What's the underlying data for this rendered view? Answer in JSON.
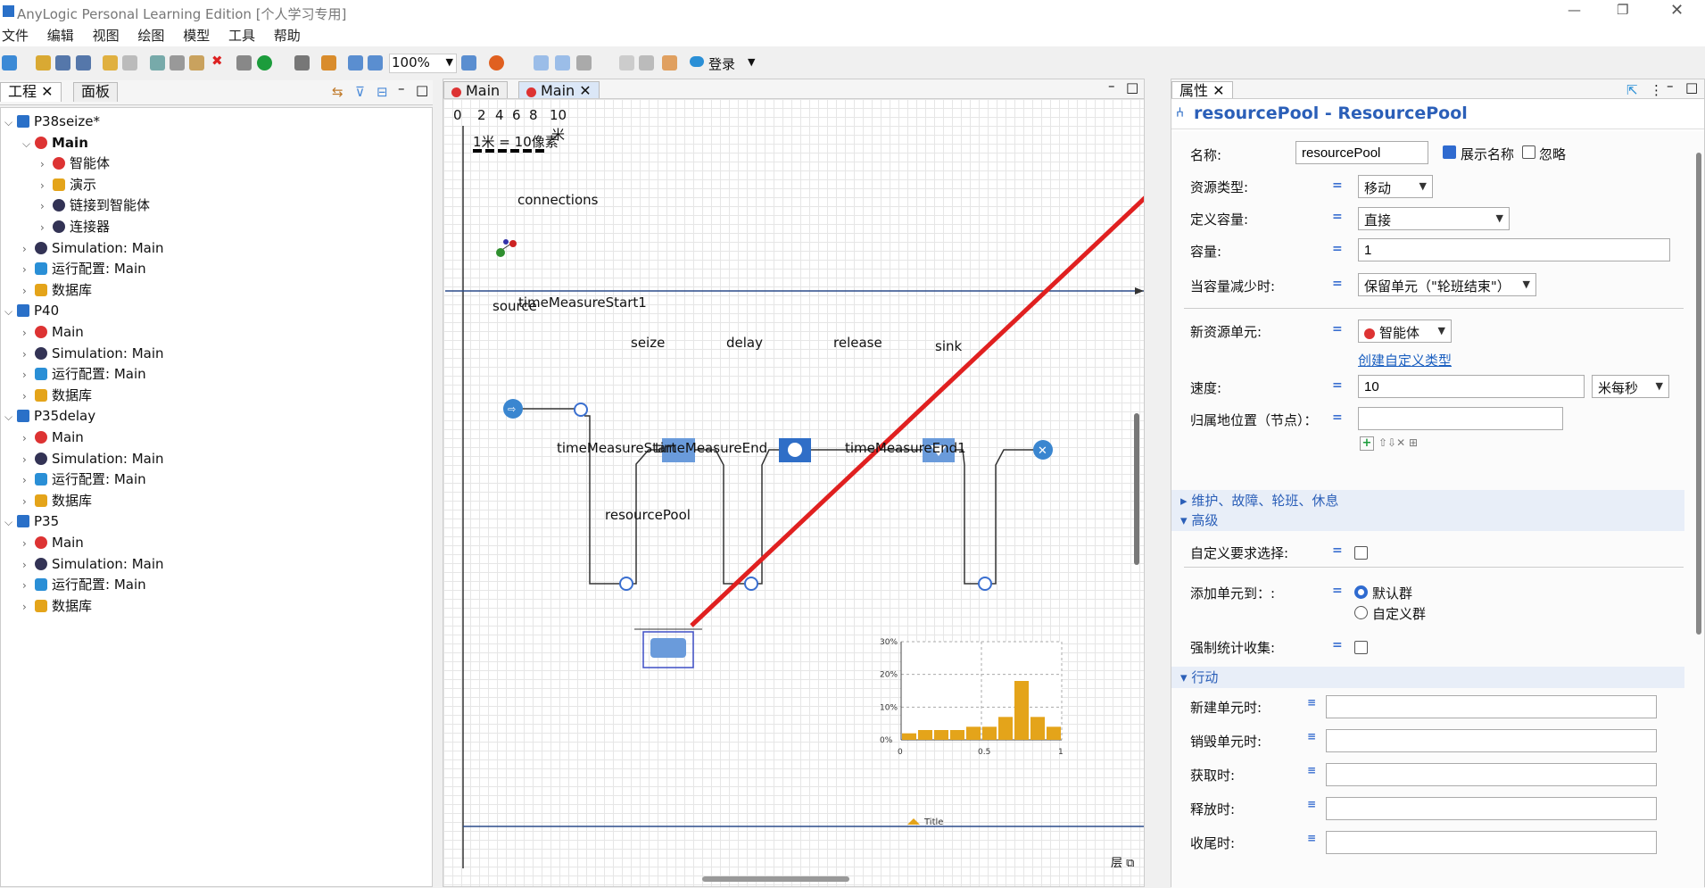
{
  "window": {
    "title": "AnyLogic Personal Learning Edition [个人学习专用]"
  },
  "menu": [
    "文件",
    "编辑",
    "视图",
    "绘图",
    "模型",
    "工具",
    "帮助"
  ],
  "toolbar": {
    "zoom": "100%",
    "login": "登录"
  },
  "left": {
    "tabs": [
      "工程",
      "面板"
    ],
    "tree": [
      {
        "label": "P38seize*",
        "level": 0,
        "icon": "project-icon",
        "expanded": true
      },
      {
        "label": "Main",
        "level": 1,
        "icon": "agent-main-icon",
        "bold": true,
        "expanded": true
      },
      {
        "label": "智能体",
        "level": 2,
        "icon": "agents-icon"
      },
      {
        "label": "演示",
        "level": 2,
        "icon": "presentation-icon"
      },
      {
        "label": "链接到智能体",
        "level": 2,
        "icon": "link-icon"
      },
      {
        "label": "连接器",
        "level": 2,
        "icon": "connector-icon"
      },
      {
        "label": "Simulation: Main",
        "level": 1,
        "icon": "simulation-icon"
      },
      {
        "label": "运行配置: Main",
        "level": 1,
        "icon": "run-config-icon"
      },
      {
        "label": "数据库",
        "level": 1,
        "icon": "database-icon"
      },
      {
        "label": "P40",
        "level": 0,
        "icon": "project-icon",
        "expanded": true
      },
      {
        "label": "Main",
        "level": 1,
        "icon": "agent-main-icon"
      },
      {
        "label": "Simulation: Main",
        "level": 1,
        "icon": "simulation-icon"
      },
      {
        "label": "运行配置: Main",
        "level": 1,
        "icon": "run-config-icon"
      },
      {
        "label": "数据库",
        "level": 1,
        "icon": "database-icon"
      },
      {
        "label": "P35delay",
        "level": 0,
        "icon": "project-icon",
        "expanded": true
      },
      {
        "label": "Main",
        "level": 1,
        "icon": "agent-main-icon"
      },
      {
        "label": "Simulation: Main",
        "level": 1,
        "icon": "simulation-icon"
      },
      {
        "label": "运行配置: Main",
        "level": 1,
        "icon": "run-config-icon"
      },
      {
        "label": "数据库",
        "level": 1,
        "icon": "database-icon"
      },
      {
        "label": "P35",
        "level": 0,
        "icon": "project-icon",
        "expanded": true
      },
      {
        "label": "Main",
        "level": 1,
        "icon": "agent-main-icon"
      },
      {
        "label": "Simulation: Main",
        "level": 1,
        "icon": "simulation-icon"
      },
      {
        "label": "运行配置: Main",
        "level": 1,
        "icon": "run-config-icon"
      },
      {
        "label": "数据库",
        "level": 1,
        "icon": "database-icon"
      }
    ]
  },
  "editor": {
    "tabs": [
      "Main",
      "Main"
    ],
    "scale": {
      "ticks": [
        "0",
        "2",
        "4",
        "6",
        "8",
        "10"
      ],
      "unit": "米",
      "note": "1米 = 10像素"
    },
    "connections": "connections",
    "blocks": {
      "source": "source",
      "tms1": "timeMeasureStart1",
      "seize": "seize",
      "delay": "delay",
      "release": "release",
      "sink": "sink",
      "tms": "timeMeasureStart",
      "tme": "timeMeasureEnd",
      "tme1": "timeMeasureEnd1",
      "pool": "resourcePool"
    },
    "chart": {
      "yticks": [
        "30%",
        "20%",
        "10%",
        "0%"
      ],
      "xticks": [
        "0",
        "0.5",
        "1"
      ],
      "legend": "Title"
    }
  },
  "chart_data": {
    "type": "bar",
    "x": [
      0.05,
      0.15,
      0.25,
      0.35,
      0.45,
      0.55,
      0.65,
      0.75,
      0.85,
      0.95
    ],
    "values": [
      2,
      3,
      3,
      3,
      4,
      4,
      7,
      18,
      7,
      4
    ],
    "ylim": [
      0,
      30
    ],
    "xlim": [
      0,
      1
    ],
    "yticks": [
      "0%",
      "10%",
      "20%",
      "30%"
    ],
    "xticks": [
      "0",
      "0.5",
      "1"
    ],
    "legend": [
      "Title"
    ]
  },
  "props": {
    "tab": "属性",
    "header": "resourcePool - ResourcePool",
    "name_label": "名称:",
    "name_value": "resourcePool",
    "show_name": "展示名称",
    "ignore": "忽略",
    "res_type_label": "资源类型:",
    "res_type": "移动",
    "cap_def_label": "定义容量:",
    "cap_def": "直接",
    "cap_label": "容量:",
    "cap_value": "1",
    "cap_dec_label": "当容量减少时:",
    "cap_dec": "保留单元（\"轮班结束\"）",
    "new_unit_label": "新资源单元:",
    "new_unit": "智能体",
    "create_type": "创建自定义类型",
    "speed_label": "速度:",
    "speed_value": "10",
    "speed_unit": "米每秒",
    "home_label": "归属地位置（节点）：",
    "sec_maint": "维护、故障、轮班、休息",
    "sec_adv": "高级",
    "custom_req": "自定义要求选择:",
    "add_to": "添加单元到：:",
    "default_pop": "默认群",
    "custom_pop": "自定义群",
    "force_stats": "强制统计收集:",
    "sec_actions": "行动",
    "actions": [
      "新建单元时:",
      "销毁单元时:",
      "获取时:",
      "释放时:",
      "收尾时:"
    ]
  }
}
